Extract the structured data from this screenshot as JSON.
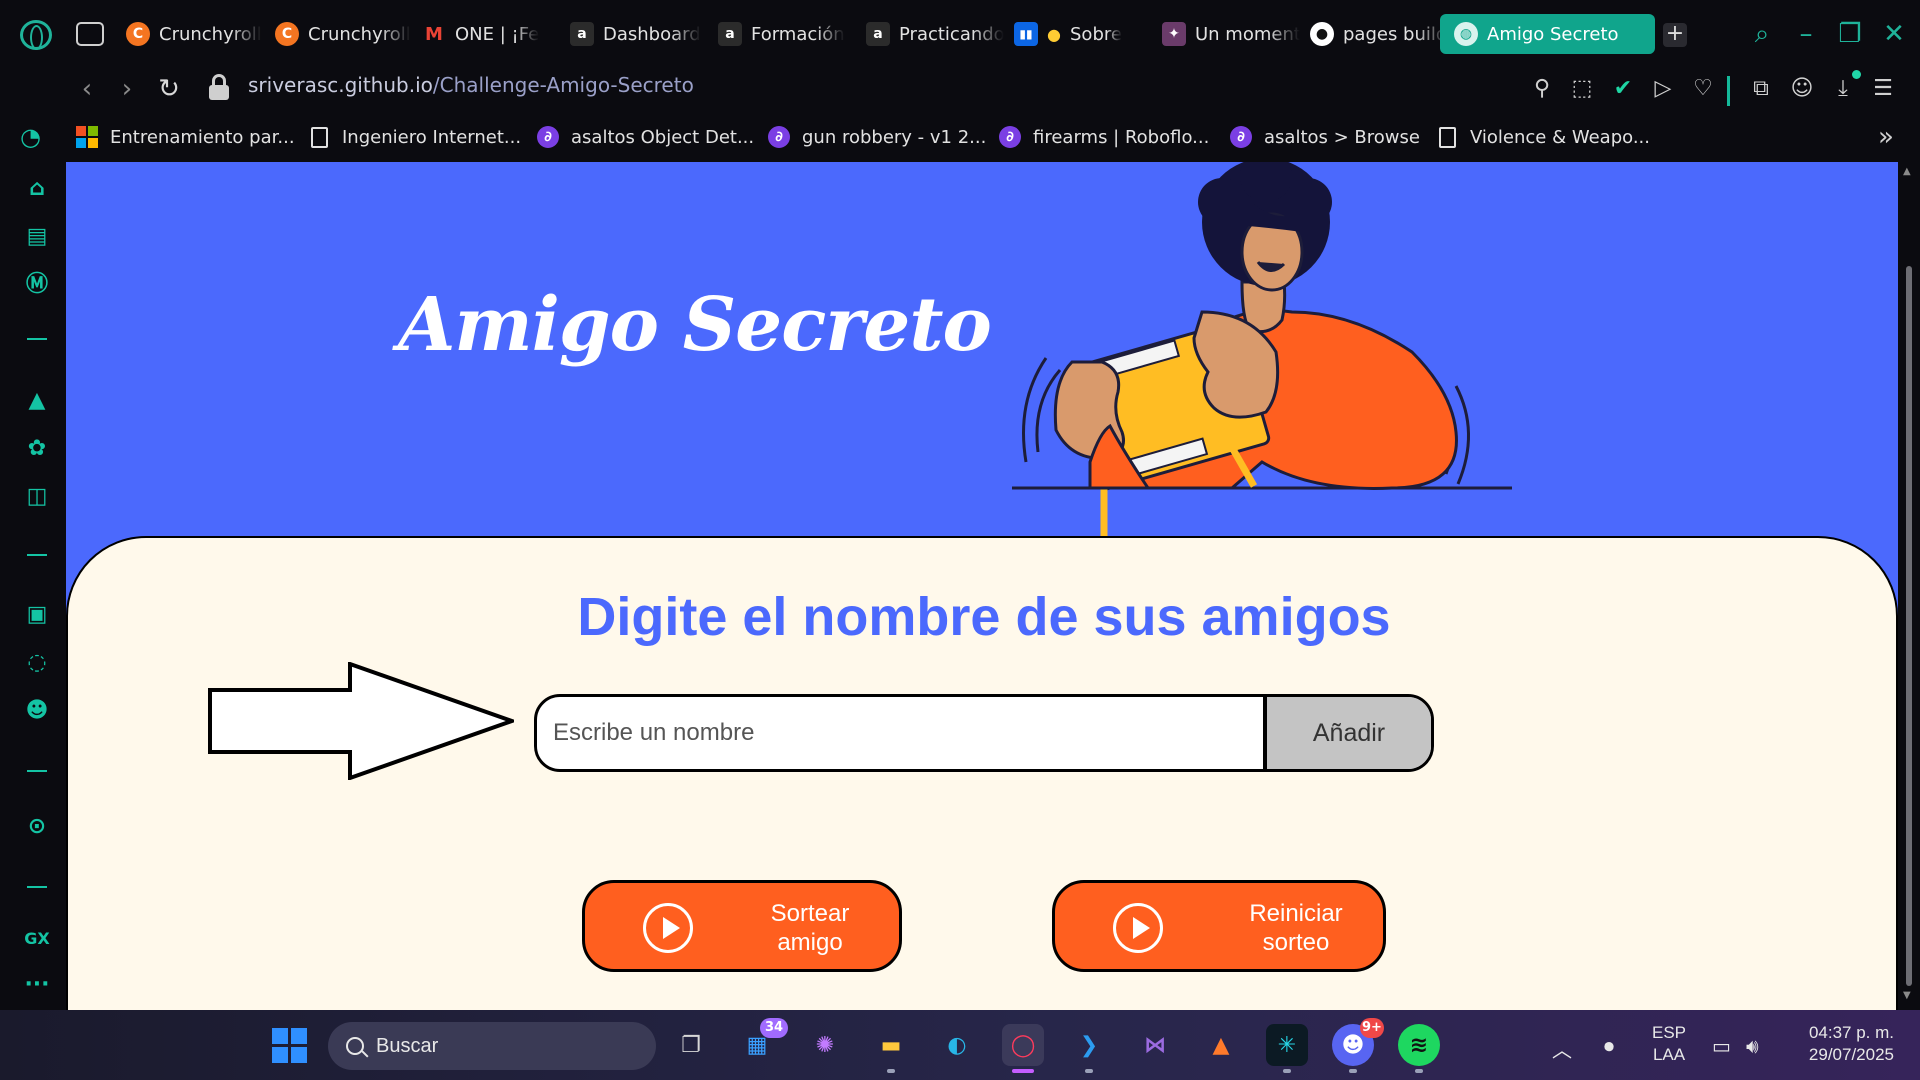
{
  "browser": {
    "tabs": [
      {
        "title": "Crunchyroll",
        "icon": "crunchyroll-icon",
        "color": "#f47521"
      },
      {
        "title": "Crunchyroll",
        "icon": "crunchyroll-icon",
        "color": "#f47521"
      },
      {
        "title": "ONE | ¡Fe",
        "icon": "gmail-icon",
        "color": "#ea4335"
      },
      {
        "title": "Dashboard",
        "icon": "alura-icon",
        "color": "#2b2b2b"
      },
      {
        "title": "Formación",
        "icon": "alura-icon",
        "color": "#2b2b2b"
      },
      {
        "title": "Practicando",
        "icon": "alura-icon",
        "color": "#2b2b2b"
      },
      {
        "title": "Sobre",
        "icon": "trello-icon",
        "color": "#0c66e4"
      },
      {
        "title": "Un momento",
        "icon": "character-icon",
        "color": "#6a3b6a"
      },
      {
        "title": "pages build",
        "icon": "github-icon",
        "color": "#ffffff"
      }
    ],
    "active_tab": {
      "title": "Amigo Secreto",
      "icon": "globe-icon"
    },
    "url": {
      "domain": "sriverasc.github.io",
      "path": "/Challenge-Amigo-Secreto"
    },
    "bookmarks": [
      {
        "label": "Entrenamiento par...",
        "icon": "microsoft-icon"
      },
      {
        "label": "Ingeniero Internet...",
        "icon": "page-icon"
      },
      {
        "label": "asaltos Object Det...",
        "icon": "roboflow-icon"
      },
      {
        "label": "gun robbery - v1 2...",
        "icon": "roboflow-icon"
      },
      {
        "label": "firearms | Roboflo...",
        "icon": "roboflow-icon"
      },
      {
        "label": "asaltos > Browse",
        "icon": "roboflow-icon"
      },
      {
        "label": "Violence & Weapo...",
        "icon": "page-icon"
      }
    ],
    "accent": "#10a58c"
  },
  "page": {
    "hero_title": "Amigo Secreto",
    "panel_title": "Digite el nombre de sus amigos",
    "input_placeholder": "Escribe un nombre",
    "input_value": "",
    "add_label": "Añadir",
    "draw_label": "Sortear amigo",
    "reset_label": "Reiniciar sorteo",
    "colors": {
      "primary": "#4b69fd",
      "button": "#ff5f1f",
      "panel": "#fff9eb",
      "add_button": "#c4c4c4"
    }
  },
  "taskbar": {
    "search_label": "Buscar",
    "store_badge": "34",
    "discord_badge": "9+",
    "lang_top": "ESP",
    "lang_bottom": "LAA",
    "time": "04:37 p. m.",
    "date": "29/07/2025"
  }
}
